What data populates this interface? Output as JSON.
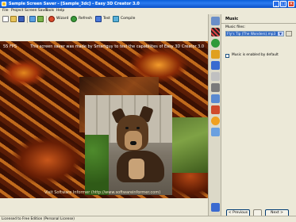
{
  "window": {
    "title": "Sample Screen Saver - [Sample_3dc] - Easy 3D Creator 3.0"
  },
  "menu": [
    "File",
    "Project",
    "Screen Saver",
    "Tools",
    "Help"
  ],
  "toolbar": {
    "wizard": "Wizard",
    "refresh": "Refresh",
    "test": "Test",
    "compile": "Compile"
  },
  "canvas": {
    "fps": "55 FPS",
    "message": "This screen saver was made by Smartguy to test the capabilites of Easy 3D Creator 3.0",
    "footer": "Visit Software Informer (http://www.softwareinformer.com)"
  },
  "panel": {
    "title": "Music",
    "music_files_label": "Music files:",
    "music_files_value": "Fly's Tip (The Wonders).mp3",
    "enable_label": "Music is enabled by default",
    "enable_checked": false,
    "previous_label": "< Previous",
    "next_label": "Next >"
  },
  "status": {
    "text": "Licensed to Free Edition (Personal License)"
  }
}
